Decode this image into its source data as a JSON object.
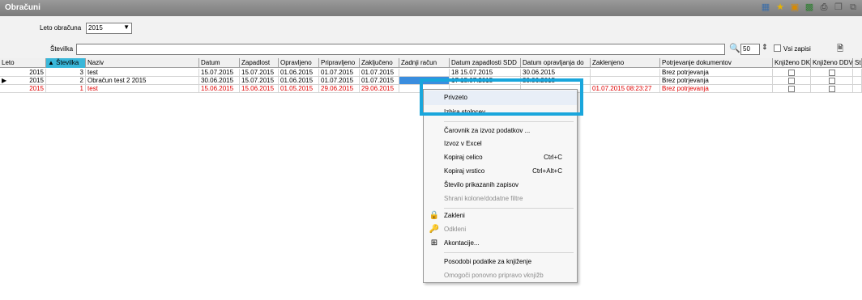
{
  "window": {
    "title": "Obračuni"
  },
  "toolbar_icons": [
    "grid-icon",
    "star-icon",
    "document-icon",
    "excel-icon",
    "print-icon",
    "copy-icon",
    "export-icon"
  ],
  "filters": {
    "year_label": "Leto obračuna",
    "year_value": "2015",
    "number_label": "Številka",
    "number_value": "",
    "records_count": "50",
    "all_records_label": "Vsi zapisi"
  },
  "grid": {
    "columns": [
      "Leto",
      "Številka",
      "Naziv",
      "Datum",
      "Zapadlost",
      "Opravljeno",
      "Pripravljeno",
      "Zaključeno",
      "Zadnji račun",
      "Datum zapadlosti SDD",
      "Datum opravljanja do",
      "Zaklenjeno",
      "Potrjevanje dokumentov",
      "Knjiženo DK",
      "Knjiženo DDV",
      "St"
    ],
    "sorted_column_arrow": "▲",
    "rows": [
      {
        "leto": "2015",
        "stevilka": "3",
        "naziv": "test",
        "datum": "15.07.2015",
        "zapadlost": "15.07.2015",
        "opravljeno": "01.06.2015",
        "pripravljeno": "01.07.2015",
        "zakljuceno": "01.07.2015",
        "zadnji_racun": "",
        "datum_sdd": "18 15.07.2015",
        "datum_do": "30.06.2015",
        "zaklenjeno": "",
        "potrjevanje": "Brez potrjevanja"
      },
      {
        "leto": "2015",
        "stevilka": "2",
        "naziv": "Obračun test 2 2015",
        "datum": "30.06.2015",
        "zapadlost": "15.07.2015",
        "opravljeno": "01.06.2015",
        "pripravljeno": "01.07.2015",
        "zakljuceno": "01.07.2015",
        "zadnji_racun": "",
        "datum_sdd": "17 15.07.2015",
        "datum_do": "30.06.2015",
        "zaklenjeno": "",
        "potrjevanje": "Brez potrjevanja"
      },
      {
        "leto": "2015",
        "stevilka": "1",
        "naziv": "test",
        "datum": "15.06.2015",
        "zapadlost": "15.06.2015",
        "opravljeno": "01.05.2015",
        "pripravljeno": "29.06.2015",
        "zakljuceno": "29.06.2015",
        "zadnji_racun": "",
        "datum_sdd": "",
        "datum_do": "",
        "zaklenjeno": "01.07.2015 08:23:27",
        "potrjevanje": "Brez potrjevanja"
      }
    ]
  },
  "context_menu": {
    "items": [
      {
        "label": "Privzeto",
        "shortcut": "",
        "icon": "",
        "disabled": false
      },
      {
        "label": "Izbira stolpcev",
        "shortcut": "",
        "icon": "",
        "disabled": false
      },
      {
        "label": "Čarovnik za izvoz podatkov ...",
        "shortcut": "",
        "icon": "",
        "disabled": false
      },
      {
        "label": "Izvoz v Excel",
        "shortcut": "",
        "icon": "",
        "disabled": false
      },
      {
        "label": "Kopiraj celico",
        "shortcut": "Ctrl+C",
        "icon": "",
        "disabled": false
      },
      {
        "label": "Kopiraj vrstico",
        "shortcut": "Ctrl+Alt+C",
        "icon": "",
        "disabled": false
      },
      {
        "label": "Število prikazanih zapisov",
        "shortcut": "",
        "icon": "",
        "disabled": false
      },
      {
        "label": "Shrani kolone/dodatne filtre",
        "shortcut": "",
        "icon": "",
        "disabled": true
      },
      {
        "label": "Zakleni",
        "shortcut": "",
        "icon": "lock-icon",
        "disabled": false
      },
      {
        "label": "Odkleni",
        "shortcut": "",
        "icon": "unlock-icon",
        "disabled": true
      },
      {
        "label": "Akontacije...",
        "shortcut": "",
        "icon": "advance-icon",
        "disabled": false
      },
      {
        "label": "Posodobi podatke za knjiženje",
        "shortcut": "",
        "icon": "",
        "disabled": false
      },
      {
        "label": "Omogoči ponovno pripravo vknjižb",
        "shortcut": "",
        "icon": "",
        "disabled": true
      }
    ]
  },
  "colors": {
    "accent": "#19a6dc",
    "sorted_header": "#3ab7d9",
    "error_row": "#e00000",
    "title_bar": "#8a8a8a"
  }
}
